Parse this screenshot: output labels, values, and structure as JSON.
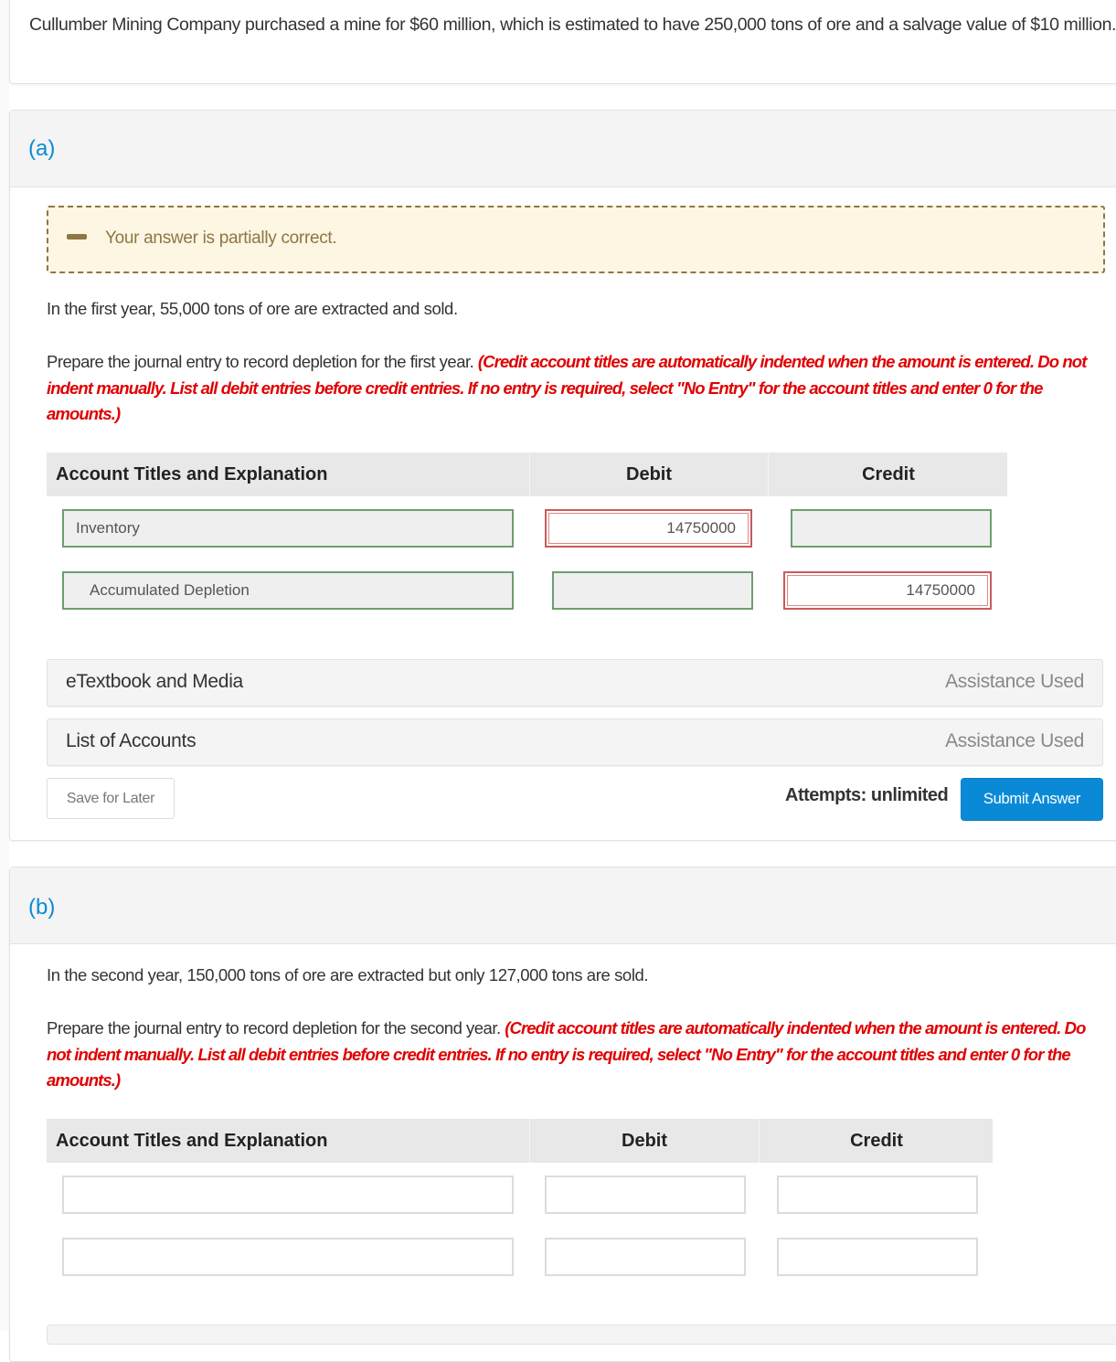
{
  "intro": {
    "text": "Cullumber Mining Company purchased a mine for $60 million, which is estimated to have 250,000 tons of ore and a salvage value of $10 million."
  },
  "parts": [
    {
      "label": "(a)",
      "feedback": {
        "icon": "partial-minus-icon",
        "text": "Your answer is partially correct."
      },
      "question": "In the first year, 55,000 tons of ore are extracted and sold.",
      "instruction_plain": "Prepare the journal entry to record depletion for the first year. ",
      "instruction_red": "(Credit account titles are automatically indented when the amount is entered. Do not indent manually. List all debit entries before credit entries. If no entry is required, select \"No Entry\" for the account titles and enter 0 for the amounts.)",
      "table": {
        "headers": [
          "Account Titles and Explanation",
          "Debit",
          "Credit"
        ],
        "rows": [
          {
            "account": "Inventory",
            "account_status": "correct",
            "debit": "14750000",
            "debit_status": "incorrect",
            "credit": "",
            "credit_status": "correct"
          },
          {
            "account": "Accumulated Depletion",
            "account_status": "correct",
            "debit": "",
            "debit_status": "correct",
            "credit": "14750000",
            "credit_status": "incorrect"
          }
        ]
      },
      "assistance": [
        {
          "label": "eTextbook and Media",
          "status": "Assistance Used"
        },
        {
          "label": "List of Accounts",
          "status": "Assistance Used"
        }
      ],
      "save_label": "Save for Later",
      "attempts": "Attempts: unlimited",
      "submit_label": "Submit Answer"
    },
    {
      "label": "(b)",
      "question": "In the second year, 150,000 tons of ore are extracted but only 127,000 tons are sold.",
      "instruction_plain": "Prepare the journal entry to record depletion for the second year. ",
      "instruction_red": "(Credit account titles are automatically indented when the amount is entered. Do not indent manually. List all debit entries before credit entries. If no entry is required, select \"No Entry\" for the account titles and enter 0 for the amounts.)",
      "table": {
        "headers": [
          "Account Titles and Explanation",
          "Debit",
          "Credit"
        ],
        "rows": [
          {
            "account": "",
            "debit": "",
            "credit": ""
          },
          {
            "account": "",
            "debit": "",
            "credit": ""
          }
        ]
      }
    }
  ],
  "colors": {
    "accent": "#0a8ad6",
    "feedback_partial": "#8f7642",
    "feedback_bg": "#fcf6e3",
    "correct_border": "#6e9e6e",
    "incorrect_border": "#c95b5b",
    "instruction_red": "#e00000"
  }
}
